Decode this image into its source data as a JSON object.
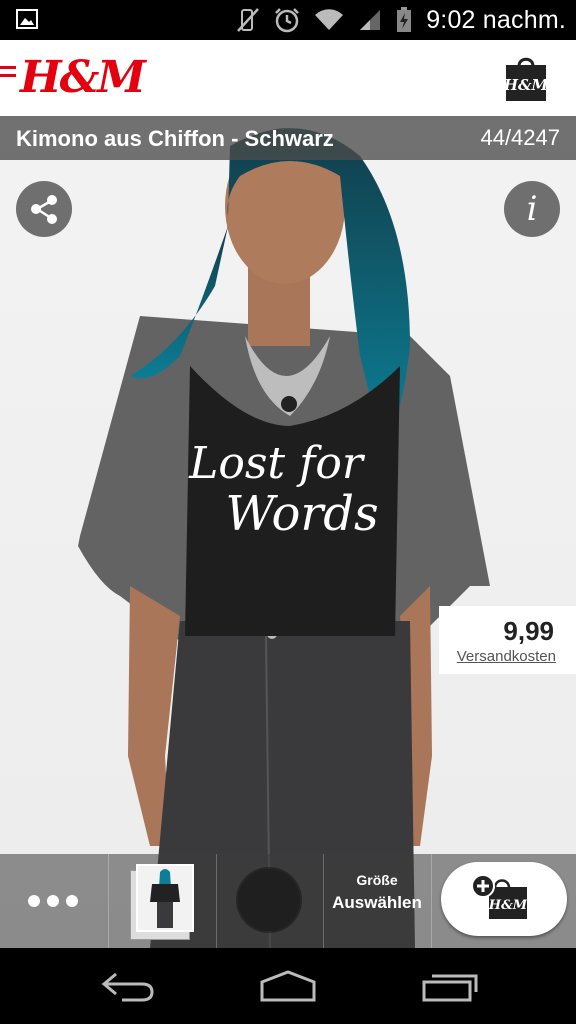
{
  "status_bar": {
    "time": "9:02 nachm.",
    "icons": [
      "gallery-notification-icon",
      "vibrate-icon",
      "alarm-icon",
      "wifi-icon",
      "signal-icon",
      "battery-icon"
    ]
  },
  "app": {
    "logo": "H&M",
    "brand_color": "#e50010",
    "bag_logo": "H&M"
  },
  "product": {
    "title": "Kimono aus Chiffon - Schwarz",
    "counter": "44/4247",
    "price": "9,99",
    "shipping_link": "Versandkosten",
    "shirt_text_line1": "Lost for",
    "shirt_text_line2": "Words"
  },
  "toolbar": {
    "size_label_top": "Größe",
    "size_label_bottom": "Auswählen",
    "add_bag_logo": "H&M",
    "selected_color": "#1f1f1f"
  },
  "nav_bar": {
    "icons": [
      "back-icon",
      "home-icon",
      "recent-apps-icon"
    ]
  }
}
